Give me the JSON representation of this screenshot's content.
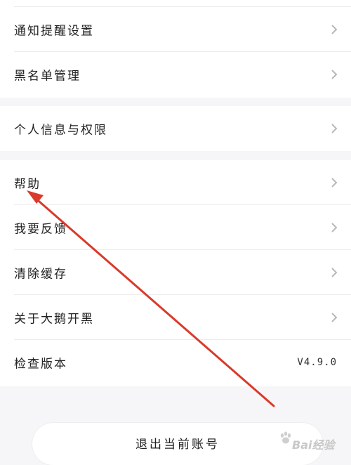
{
  "settings": {
    "group1": [
      {
        "label": "通知提醒设置"
      },
      {
        "label": "黑名单管理"
      }
    ],
    "group2": [
      {
        "label": "个人信息与权限"
      }
    ],
    "group3": [
      {
        "label": "帮助"
      },
      {
        "label": "我要反馈"
      },
      {
        "label": "清除缓存"
      },
      {
        "label": "关于大鹅开黑"
      },
      {
        "label": "检查版本",
        "value": "V4.9.0"
      }
    ]
  },
  "logout_label": "退出当前账号",
  "watermark": {
    "brand": "Bai",
    "suffix": "经验"
  },
  "colors": {
    "background": "#f6f6f8",
    "annotation_arrow": "#d93a2b",
    "chevron": "#b8b8b8"
  }
}
